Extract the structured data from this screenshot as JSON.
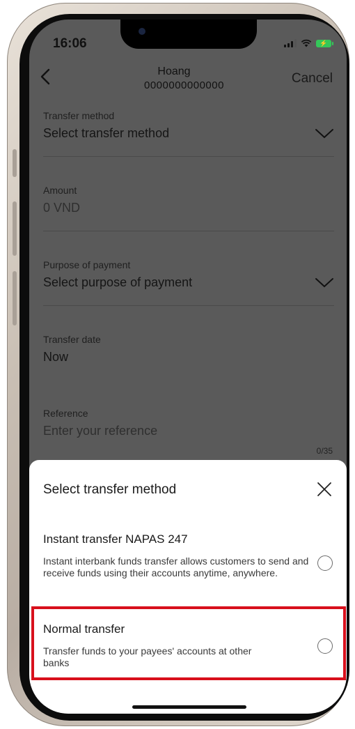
{
  "status_bar": {
    "time": "16:06"
  },
  "header": {
    "payee_name": "Hoang",
    "account_number": "0000000000000",
    "cancel_label": "Cancel"
  },
  "form": {
    "transfer_method": {
      "label": "Transfer method",
      "value": "Select transfer method"
    },
    "amount": {
      "label": "Amount",
      "value": "0 VND"
    },
    "purpose": {
      "label": "Purpose of payment",
      "value": "Select purpose of payment"
    },
    "transfer_date": {
      "label": "Transfer date",
      "value": "Now"
    },
    "reference": {
      "label": "Reference",
      "placeholder": "Enter your reference",
      "counter": "0/35"
    }
  },
  "sheet": {
    "title": "Select transfer method",
    "options": [
      {
        "title": "Instant transfer NAPAS 247",
        "description": "Instant interbank funds transfer allows customers to send and receive funds using their accounts anytime, anywhere.",
        "selected": false
      },
      {
        "title": "Normal transfer",
        "description": "Transfer funds to your payees' accounts at other banks",
        "selected": false
      }
    ]
  },
  "colors": {
    "highlight": "#d8101c",
    "battery": "#34c759",
    "overlay": "#5a5a5a"
  }
}
